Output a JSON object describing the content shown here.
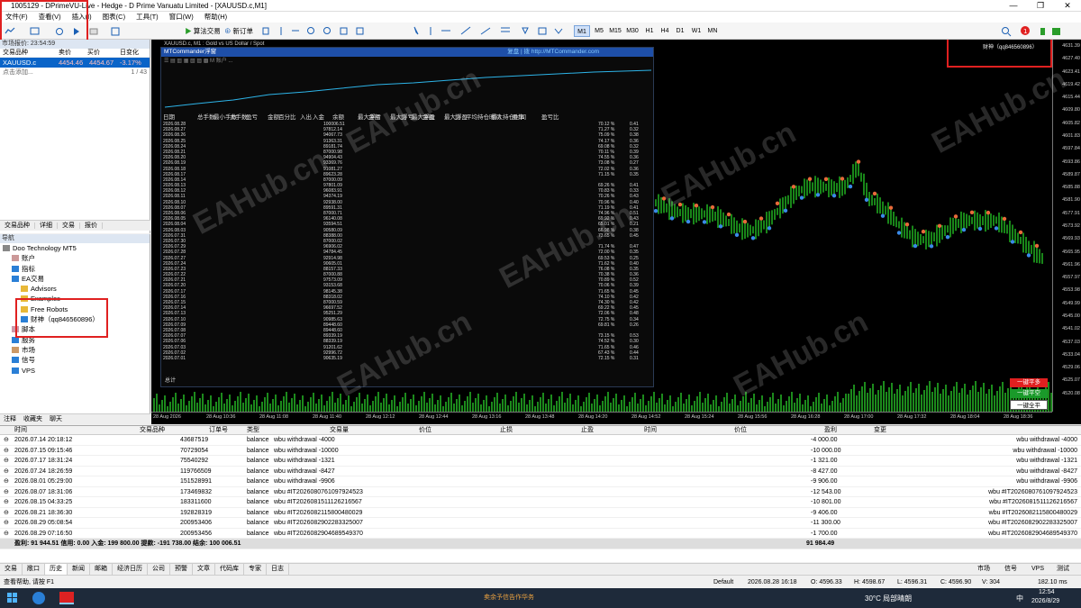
{
  "window": {
    "title": "1005129 - DPrimeVU-Live - Hedge - D Prime Vanuatu Limited - [XAUUSD.c,M1]",
    "controls": [
      "—",
      "❐",
      "✕"
    ]
  },
  "menu": [
    "文件(F)",
    "查看(V)",
    "插入(I)",
    "图表(C)",
    "工具(T)",
    "窗口(W)",
    "帮助(H)"
  ],
  "toolbar": {
    "algo_label": "算法交易",
    "new_order_label": "新订单",
    "timeframes": [
      "M1",
      "M5",
      "M15",
      "M30",
      "H1",
      "H4",
      "D1",
      "W1",
      "MN"
    ],
    "active_timeframe": "M1"
  },
  "market_watch": {
    "title": "市场报价: 23:54:59",
    "columns": [
      "交易品种",
      "卖价",
      "买价",
      "日变化"
    ],
    "row": {
      "symbol": "XAUUSD.c",
      "bid": "4454.46",
      "ask": "4454.67",
      "change": "-3.17%"
    },
    "add_label": "点击添加...",
    "count": "1 / 43",
    "tabs": [
      "交易品种",
      "详细",
      "交易",
      "报价"
    ]
  },
  "navigator": {
    "title": "导航",
    "items": [
      {
        "label": "Doo Technology MT5",
        "indent": 0
      },
      {
        "label": "账户",
        "indent": 1
      },
      {
        "label": "指标",
        "indent": 1
      },
      {
        "label": "EA交易",
        "indent": 1
      },
      {
        "label": "Advisors",
        "indent": 2
      },
      {
        "label": "Examples",
        "indent": 2
      },
      {
        "label": "Free Robots",
        "indent": 2
      },
      {
        "label": "财神（qq846560896）",
        "indent": 2
      },
      {
        "label": "脚本",
        "indent": 1
      },
      {
        "label": "服务",
        "indent": 1
      },
      {
        "label": "市场",
        "indent": 1
      },
      {
        "label": "信号",
        "indent": 1
      },
      {
        "label": "VPS",
        "indent": 1
      }
    ],
    "tabs": [
      "注释",
      "收藏夹",
      "聊天"
    ]
  },
  "chart": {
    "tab_title": "XAUUSD.c, M1 : Gold vs US Dollar / Spot",
    "ea_label": "财神（qq846560896）",
    "price_labels": [
      "4631.39",
      "4627.40",
      "4623.41",
      "4619.42",
      "4615.44",
      "4609.80",
      "4605.82",
      "4601.83",
      "4597.84",
      "4593.86",
      "4589.87",
      "4585.88",
      "4581.90",
      "4577.91",
      "4573.92",
      "4569.93",
      "4565.95",
      "4561.96",
      "4557.97",
      "4553.98",
      "4549.99",
      "4545.00",
      "4541.02",
      "4537.03",
      "4533.04",
      "4529.06",
      "4525.07",
      "4520.08"
    ],
    "time_labels": [
      "28 Aug 2026",
      "28 Aug 10:36",
      "28 Aug 11:08",
      "28 Aug 11:40",
      "28 Aug 12:12",
      "28 Aug 12:44",
      "28 Aug 13:16",
      "28 Aug 13:48",
      "28 Aug 14:20",
      "28 Aug 14:52",
      "28 Aug 15:24",
      "28 Aug 15:56",
      "28 Aug 16:28",
      "28 Aug 17:00",
      "28 Aug 17:32",
      "28 Aug 18:04",
      "28 Aug 18:36"
    ],
    "buttons": [
      "一键平多",
      "一键平空",
      "一键全平"
    ],
    "watermark": "EAHub.cn"
  },
  "mtcommander": {
    "title": "MTCommander浮窗",
    "link_label": "复盘 | 拨 http://MTCommander.com",
    "columns": [
      "日期",
      "总手数",
      "最小手数",
      "大手数",
      "盈亏",
      "金额",
      "百分比",
      "入出",
      "入金",
      "余额",
      "最大浮亏",
      "金额",
      "最大浮亏",
      "比",
      "最大浮盈",
      "金额",
      "最大浮盈",
      "比",
      "平均持仓时间",
      "最大持仓时间",
      "胜率",
      "盈亏比"
    ],
    "rows": [
      {
        "date": "2026.08.28",
        "balance": "100006.51",
        "winrate": "70.12 %",
        "pf": "0.41"
      },
      {
        "date": "2026.08.27",
        "balance": "97812.14",
        "winrate": "71.27 %",
        "pf": "0.32"
      },
      {
        "date": "2026.08.26",
        "balance": "94067.73",
        "winrate": "75.09 %",
        "pf": "0.38"
      },
      {
        "date": "2026.08.25",
        "balance": "91363.31",
        "winrate": "74.17 %",
        "pf": "0.36"
      },
      {
        "date": "2026.08.24",
        "balance": "89181.74",
        "winrate": "69.08 %",
        "pf": "0.32"
      },
      {
        "date": "2026.08.21",
        "balance": "87000.98",
        "winrate": "70.11 %",
        "pf": "0.39"
      },
      {
        "date": "2026.08.20",
        "balance": "94904.43",
        "winrate": "74.55 %",
        "pf": "0.36"
      },
      {
        "date": "2026.08.19",
        "balance": "93369.76",
        "winrate": "73.08 %",
        "pf": "0.27"
      },
      {
        "date": "2026.08.18",
        "balance": "91081.27",
        "winrate": "72.02 %",
        "pf": "0.36"
      },
      {
        "date": "2026.08.17",
        "balance": "89623.28",
        "winrate": "71.15 %",
        "pf": "0.35"
      },
      {
        "date": "2026.08.14",
        "balance": "87000.09",
        "winrate": "",
        "pf": ""
      },
      {
        "date": "2026.08.13",
        "balance": "97801.09",
        "winrate": "69.26 %",
        "pf": "0.41"
      },
      {
        "date": "2026.08.12",
        "balance": "96083.91",
        "winrate": "70.83 %",
        "pf": "0.33"
      },
      {
        "date": "2026.08.11",
        "balance": "94374.19",
        "winrate": "70.26 %",
        "pf": "0.43"
      },
      {
        "date": "2026.08.10",
        "balance": "92938.00",
        "winrate": "70.96 %",
        "pf": "0.40"
      },
      {
        "date": "2026.08.07",
        "balance": "89591.31",
        "winrate": "71.19 %",
        "pf": "0.41"
      },
      {
        "date": "2026.08.06",
        "balance": "87000.71",
        "winrate": "74.96 %",
        "pf": "0.51"
      },
      {
        "date": "2026.08.05",
        "balance": "96140.08",
        "winrate": "69.92 %",
        "pf": "0.43"
      },
      {
        "date": "2026.08.04",
        "balance": "93594.51",
        "winrate": "65.01 %",
        "pf": "0.21"
      },
      {
        "date": "2026.08.03",
        "balance": "90580.09",
        "winrate": "66.98 %",
        "pf": "0.38"
      },
      {
        "date": "2026.07.31",
        "balance": "88388.00",
        "winrate": "73.65 %",
        "pf": "0.45"
      },
      {
        "date": "2026.07.30",
        "balance": "87000.02",
        "winrate": "",
        "pf": ""
      },
      {
        "date": "2026.07.29",
        "balance": "96906.02",
        "winrate": "71.74 %",
        "pf": "0.47"
      },
      {
        "date": "2026.07.28",
        "balance": "94784.45",
        "winrate": "72.00 %",
        "pf": "0.35"
      },
      {
        "date": "2026.07.27",
        "balance": "92914.98",
        "winrate": "69.53 %",
        "pf": "0.25"
      },
      {
        "date": "2026.07.24",
        "balance": "90605.01",
        "winrate": "71.62 %",
        "pf": "0.40"
      },
      {
        "date": "2026.07.23",
        "balance": "88157.33",
        "winrate": "76.08 %",
        "pf": "0.35"
      },
      {
        "date": "2026.07.22",
        "balance": "87000.88",
        "winrate": "70.38 %",
        "pf": "0.36"
      },
      {
        "date": "2026.07.21",
        "balance": "97573.09",
        "winrate": "70.89 %",
        "pf": "0.52"
      },
      {
        "date": "2026.07.20",
        "balance": "93153.68",
        "winrate": "70.06 %",
        "pf": "0.39"
      },
      {
        "date": "2026.07.17",
        "balance": "98145.38",
        "winrate": "71.65 %",
        "pf": "0.45"
      },
      {
        "date": "2026.07.16",
        "balance": "88318.02",
        "winrate": "74.10 %",
        "pf": "0.42"
      },
      {
        "date": "2026.07.15",
        "balance": "87000.59",
        "winrate": "74.30 %",
        "pf": "0.42"
      },
      {
        "date": "2026.07.14",
        "balance": "96697.52",
        "winrate": "69.22 %",
        "pf": "0.45"
      },
      {
        "date": "2026.07.13",
        "balance": "95251.29",
        "winrate": "72.06 %",
        "pf": "0.48"
      },
      {
        "date": "2026.07.10",
        "balance": "90985.63",
        "winrate": "72.75 %",
        "pf": "0.34"
      },
      {
        "date": "2026.07.09",
        "balance": "89448.60",
        "winrate": "69.81 %",
        "pf": "0.26"
      },
      {
        "date": "2026.07.08",
        "balance": "89448.60",
        "winrate": "",
        "pf": ""
      },
      {
        "date": "2026.07.07",
        "balance": "89339.19",
        "winrate": "73.15 %",
        "pf": "0.53"
      },
      {
        "date": "2026.07.06",
        "balance": "88339.19",
        "winrate": "74.52 %",
        "pf": "0.30"
      },
      {
        "date": "2026.07.03",
        "balance": "91201.62",
        "winrate": "71.65 %",
        "pf": "0.46"
      },
      {
        "date": "2026.07.02",
        "balance": "92996.72",
        "winrate": "67.43 %",
        "pf": "0.44"
      },
      {
        "date": "2026.07.01",
        "balance": "90635.19",
        "winrate": "72.15 %",
        "pf": "0.31"
      }
    ],
    "total_label": "总计"
  },
  "history": {
    "columns": [
      "时间",
      "交易品种",
      "订单号",
      "类型",
      "交易量",
      "价位",
      "止损",
      "止盈",
      "时间",
      "价位",
      "盈利",
      "变更"
    ],
    "rows": [
      {
        "time": "2026.07.14 20:18:12",
        "ticket": "43687519",
        "type": "balance",
        "comment": "wbu withdrawal -4000",
        "profit": "-4 000.00",
        "note": "wbu withdrawal -4000"
      },
      {
        "time": "2026.07.15 09:15:46",
        "ticket": "70729054",
        "type": "balance",
        "comment": "wbu withdrawal -10000",
        "profit": "-10 000.00",
        "note": "wbu withdrawal -10000"
      },
      {
        "time": "2026.07.17 18:31:24",
        "ticket": "75540292",
        "type": "balance",
        "comment": "wbu withdrawal -1321",
        "profit": "-1 321.00",
        "note": "wbu withdrawal -1321"
      },
      {
        "time": "2026.07.24 18:26:59",
        "ticket": "119766509",
        "type": "balance",
        "comment": "wbu withdrawal -8427",
        "profit": "-8 427.00",
        "note": "wbu withdrawal -8427"
      },
      {
        "time": "2026.08.01 05:29:00",
        "ticket": "151528991",
        "type": "balance",
        "comment": "wbu withdrawal -9906",
        "profit": "-9 906.00",
        "note": "wbu withdrawal -9906"
      },
      {
        "time": "2026.08.07 18:31:06",
        "ticket": "173469832",
        "type": "balance",
        "comment": "wbu #IT20260807610979245​23",
        "profit": "-12 543.00",
        "note": "wbu #IT20260807610979245​23"
      },
      {
        "time": "2026.08.15 04:33:25",
        "ticket": "183311600",
        "type": "balance",
        "comment": "wbu #IT20260815111262165​67",
        "profit": "-10 801.00",
        "note": "wbu #IT20260815111262165​67"
      },
      {
        "time": "2026.08.21 18:36:30",
        "ticket": "192828319",
        "type": "balance",
        "comment": "wbu #IT20260821158004800​29",
        "profit": "-9 406.00",
        "note": "wbu #IT20260821158004800​29"
      },
      {
        "time": "2026.08.29 05:08:54",
        "ticket": "200953406",
        "type": "balance",
        "comment": "wbu #IT20260829022833250​07",
        "profit": "-11 300.00",
        "note": "wbu #IT20260829022833250​07"
      },
      {
        "time": "2026.08.29 07:16:50",
        "ticket": "200953456",
        "type": "balance",
        "comment": "wbu #IT20260829046895493​70",
        "profit": "-1 700.00",
        "note": "wbu #IT20260829046895493​70"
      }
    ],
    "summary": "盈利: 91 944.51  信用: 0.00  入金: 199 800.00  提款: -191 738.00  结余: 100 006.51",
    "summary_total": "91 984.49"
  },
  "bottom_tabs": [
    "交易",
    "敞口",
    "历史",
    "新闻",
    "邮箱",
    "经济日历",
    "公司",
    "预警",
    "文章",
    "代码库",
    "专家",
    "日志"
  ],
  "bottom_right": [
    "市场",
    "信号",
    "VPS",
    "测试"
  ],
  "status": {
    "help": "查看帮助, 请按 F1",
    "profile": "Default",
    "datetime": "2026.08.28 16:18",
    "open": "O: 4596.33",
    "high": "H: 4598.67",
    "low": "L: 4596.31",
    "close": "C: 4596.90",
    "volume": "V: 304",
    "speed": "182.10 ms"
  },
  "taskbar": {
    "weather": "30°C  局部晴朗",
    "time": "12:54",
    "date": "2026/8/29",
    "ime": "中",
    "notice": "卖余予信告作华务"
  }
}
